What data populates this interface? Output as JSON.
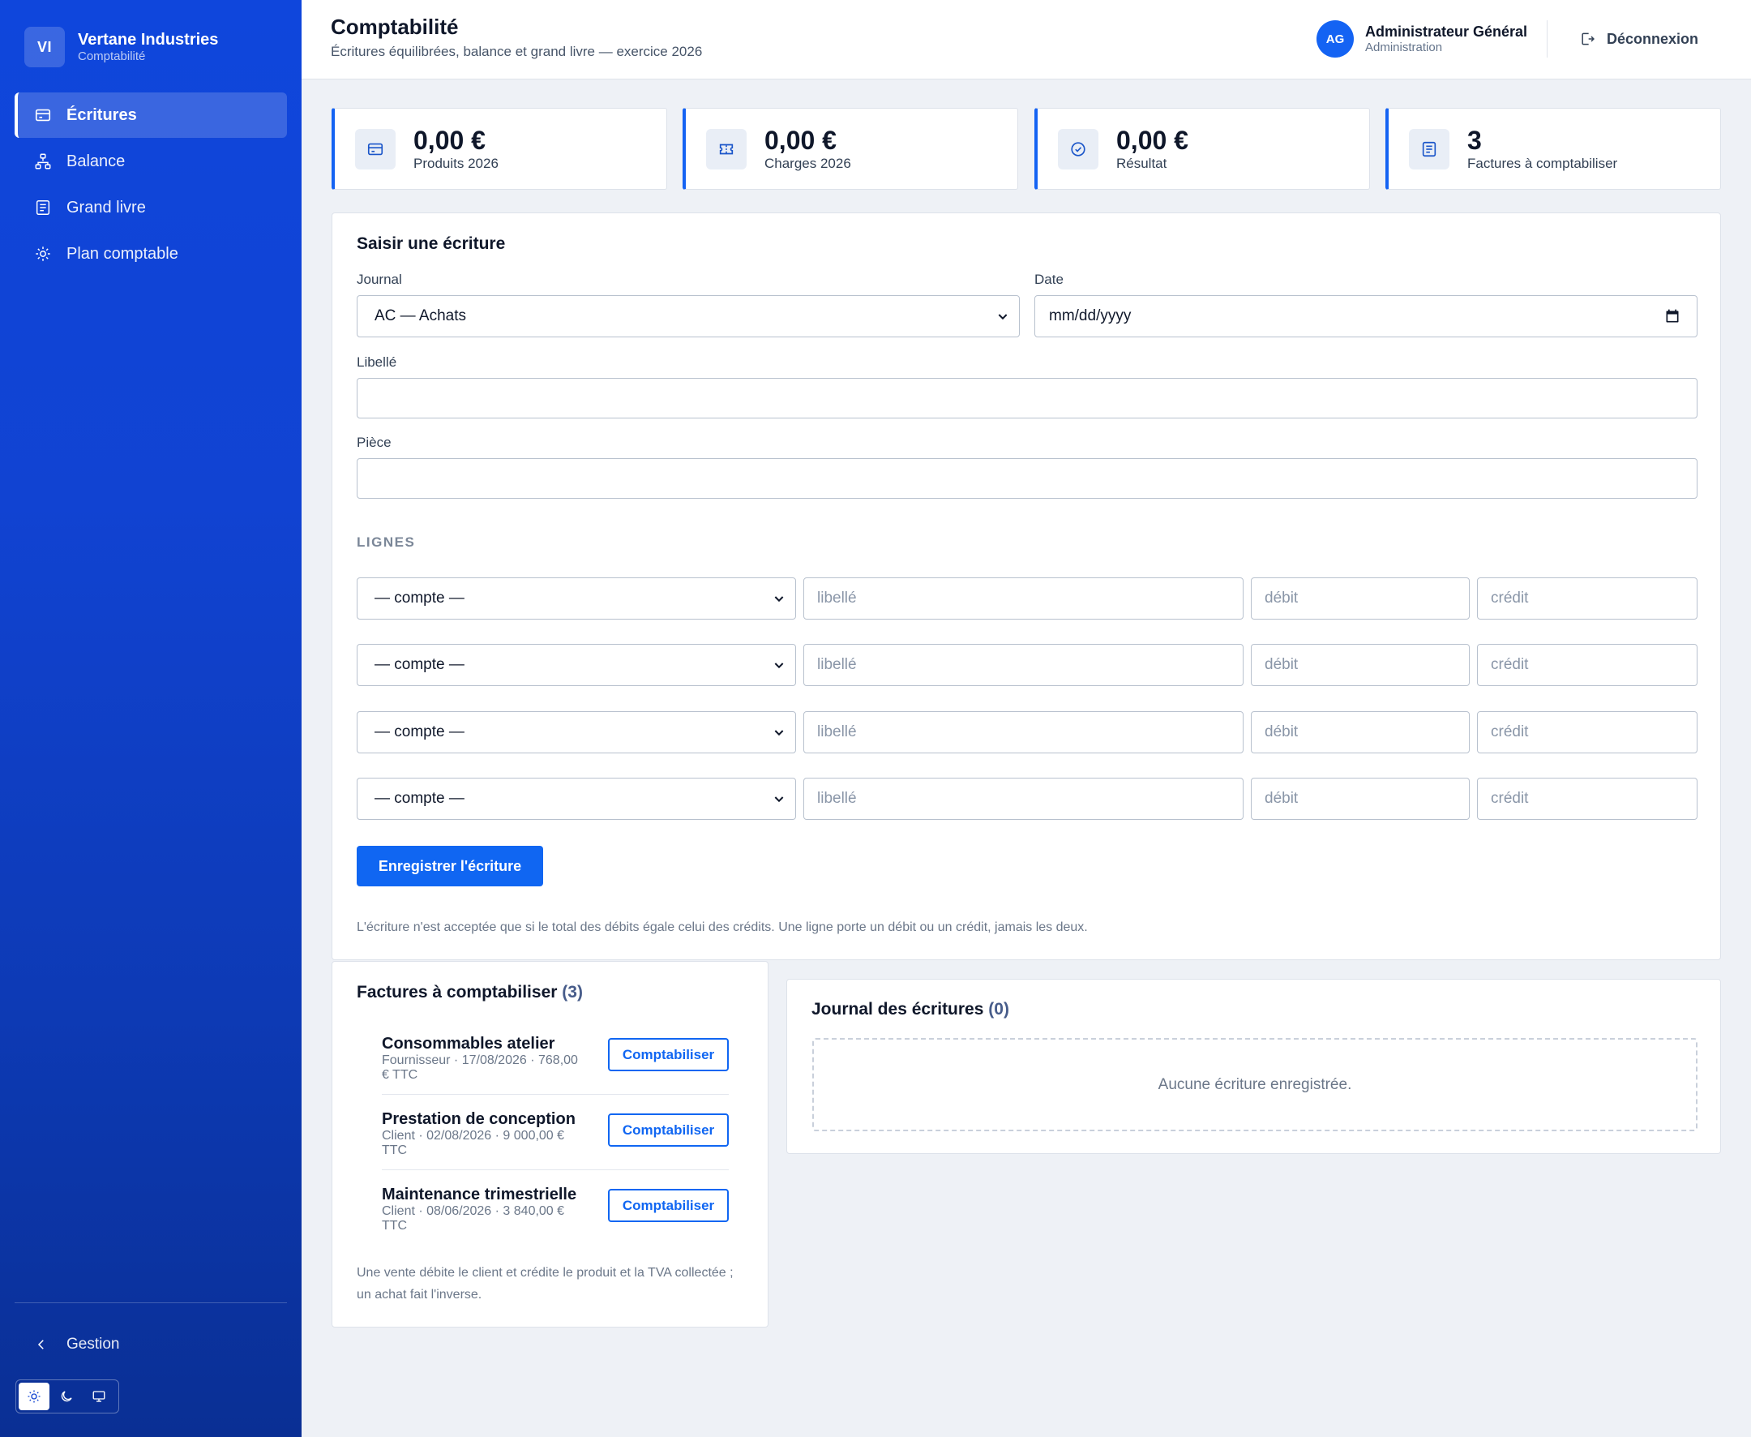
{
  "brand": {
    "initials": "VI",
    "name": "Vertane Industries",
    "module": "Comptabilité"
  },
  "nav": [
    {
      "label": "Écritures",
      "icon": "card-icon",
      "active": true
    },
    {
      "label": "Balance",
      "icon": "hierarchy-icon",
      "active": false
    },
    {
      "label": "Grand livre",
      "icon": "ledger-icon",
      "active": false
    },
    {
      "label": "Plan comptable",
      "icon": "gear-icon",
      "active": false
    }
  ],
  "sidebar_footer": {
    "back_label": "Gestion"
  },
  "header": {
    "title": "Comptabilité",
    "subtitle": "Écritures équilibrées, balance et grand livre — exercice 2026"
  },
  "user": {
    "initials": "AG",
    "name": "Administrateur Général",
    "role": "Administration"
  },
  "logout_label": "Déconnexion",
  "stats": [
    {
      "value": "0,00 €",
      "label": "Produits 2026",
      "icon": "card-icon"
    },
    {
      "value": "0,00 €",
      "label": "Charges 2026",
      "icon": "ticket-icon"
    },
    {
      "value": "0,00 €",
      "label": "Résultat",
      "icon": "check-circle-icon"
    },
    {
      "value": "3",
      "label": "Factures à comptabiliser",
      "icon": "document-icon"
    }
  ],
  "entry_form": {
    "title": "Saisir une écriture",
    "journal_label": "Journal",
    "journal_value": "AC — Achats",
    "date_label": "Date",
    "date_placeholder": "mm/dd/yyyy",
    "libelle_label": "Libellé",
    "libelle_value": "",
    "piece_label": "Pièce",
    "piece_value": "",
    "lines_caption": "LIGNES",
    "lines": [
      {
        "account": "— compte —",
        "libelle_ph": "libellé",
        "debit_ph": "débit",
        "credit_ph": "crédit"
      },
      {
        "account": "— compte —",
        "libelle_ph": "libellé",
        "debit_ph": "débit",
        "credit_ph": "crédit"
      },
      {
        "account": "— compte —",
        "libelle_ph": "libellé",
        "debit_ph": "débit",
        "credit_ph": "crédit"
      },
      {
        "account": "— compte —",
        "libelle_ph": "libellé",
        "debit_ph": "débit",
        "credit_ph": "crédit"
      }
    ],
    "submit_label": "Enregistrer l'écriture",
    "help": "L'écriture n'est acceptée que si le total des débits égale celui des crédits. Une ligne porte un débit ou un crédit, jamais les deux."
  },
  "invoices": {
    "title": "Factures à comptabiliser",
    "count": "(3)",
    "items": [
      {
        "title": "Consommables atelier",
        "meta": "Fournisseur · 17/08/2026 · 768,00 € TTC",
        "action": "Comptabiliser"
      },
      {
        "title": "Prestation de conception",
        "meta": "Client · 02/08/2026 · 9 000,00 € TTC",
        "action": "Comptabiliser"
      },
      {
        "title": "Maintenance trimestrielle",
        "meta": "Client · 08/06/2026 · 3 840,00 € TTC",
        "action": "Comptabiliser"
      }
    ],
    "help": "Une vente débite le client et crédite le produit et la TVA collectée ; un achat fait l'inverse."
  },
  "journal": {
    "title": "Journal des écritures",
    "count": "(0)",
    "empty": "Aucune écriture enregistrée."
  },
  "colors": {
    "accent": "#1066f2",
    "sidebar": "#0f46dc"
  }
}
